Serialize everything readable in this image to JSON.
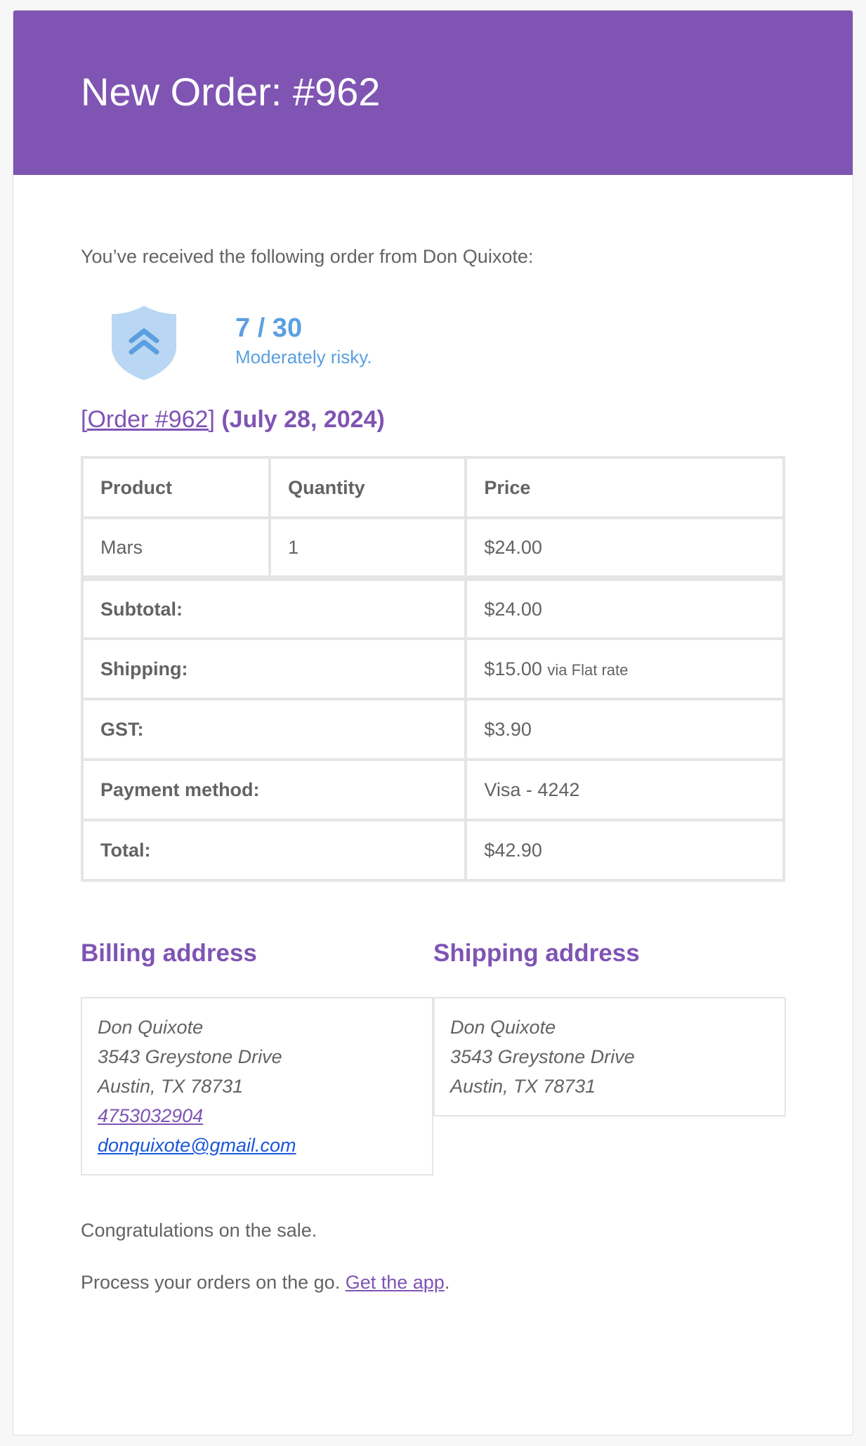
{
  "header": {
    "title": "New Order: #962",
    "background_color": "#7f54b3"
  },
  "intro": "You’ve received the following order from Don Quixote:",
  "risk": {
    "icon": "shield-chevron-up-icon",
    "score": "7 / 30",
    "label": "Moderately risky.",
    "color": "#5b9fe0"
  },
  "order": {
    "link_text": "[Order #962]",
    "date": "(July 28, 2024)"
  },
  "table": {
    "headers": [
      "Product",
      "Quantity",
      "Price"
    ],
    "items": [
      {
        "product": "Mars",
        "quantity": "1",
        "price": "$24.00"
      }
    ],
    "totals": [
      {
        "label": "Subtotal:",
        "value": "$24.00",
        "note": ""
      },
      {
        "label": "Shipping:",
        "value": "$15.00",
        "note": "via Flat rate"
      },
      {
        "label": "GST:",
        "value": "$3.90",
        "note": ""
      },
      {
        "label": "Payment method:",
        "value": "Visa - 4242",
        "note": ""
      },
      {
        "label": "Total:",
        "value": "$42.90",
        "note": ""
      }
    ]
  },
  "billing": {
    "heading": "Billing address",
    "name": "Don Quixote",
    "street": "3543 Greystone Drive",
    "city": "Austin, TX 78731",
    "phone": "4753032904",
    "email": "donquixote@gmail.com"
  },
  "shipping": {
    "heading": "Shipping address",
    "name": "Don Quixote",
    "street": "3543 Greystone Drive",
    "city": "Austin, TX 78731"
  },
  "footer": {
    "congrats": "Congratulations on the sale.",
    "process_text": "Process your orders on the go.",
    "app_link": "Get the app",
    "period": "."
  }
}
